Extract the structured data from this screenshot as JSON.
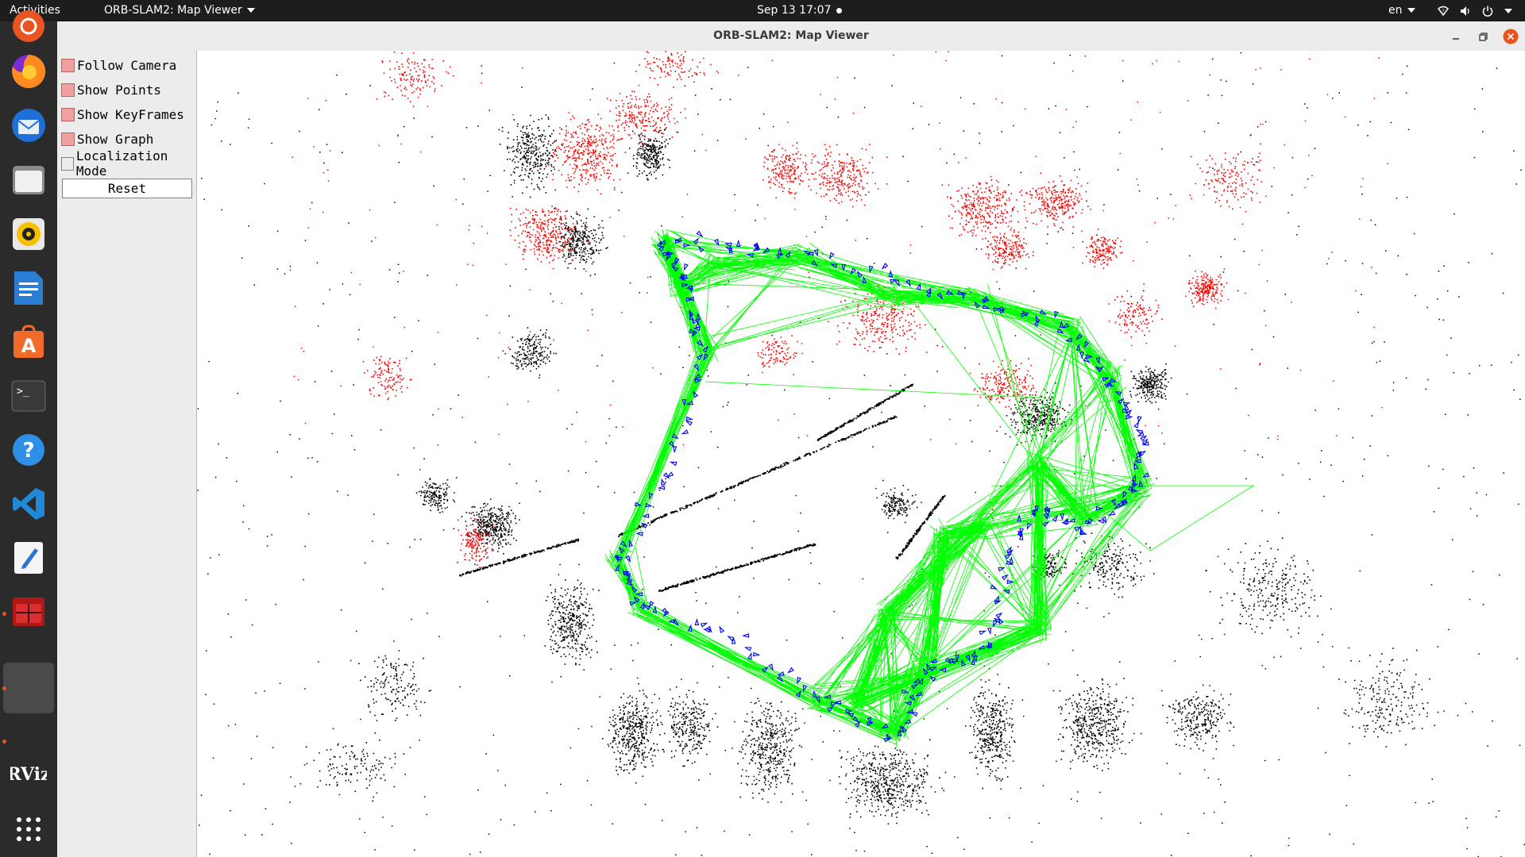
{
  "topbar": {
    "activities": "Activities",
    "app_menu": "ORB-SLAM2: Map Viewer",
    "clock": "Sep 13  17:07",
    "lang": "en"
  },
  "dock": {
    "items": [
      "ubuntu-icon",
      "firefox-icon",
      "thunderbird-icon",
      "files-icon",
      "rhythmbox-icon",
      "libreoffice-writer-icon",
      "software-center-icon",
      "terminal-icon",
      "help-icon",
      "vscode-icon",
      "text-editor-icon",
      "orbslam-icon",
      "active-window-icon",
      "rviz-icon",
      "show-apps-icon"
    ],
    "rviz_label": "RViz"
  },
  "window": {
    "title": "ORB-SLAM2: Map Viewer"
  },
  "panel": {
    "options": [
      {
        "label": "Follow Camera",
        "checked": true
      },
      {
        "label": "Show Points",
        "checked": true
      },
      {
        "label": "Show KeyFrames",
        "checked": true
      },
      {
        "label": "Show Graph",
        "checked": true
      },
      {
        "label": "Localization Mode",
        "checked": false
      }
    ],
    "reset": "Reset"
  },
  "map": {
    "colors": {
      "map_points": "#000000",
      "reference_points": "#ff0000",
      "keyframes": "#0000ff",
      "covisibility_graph": "#00ff00"
    }
  }
}
